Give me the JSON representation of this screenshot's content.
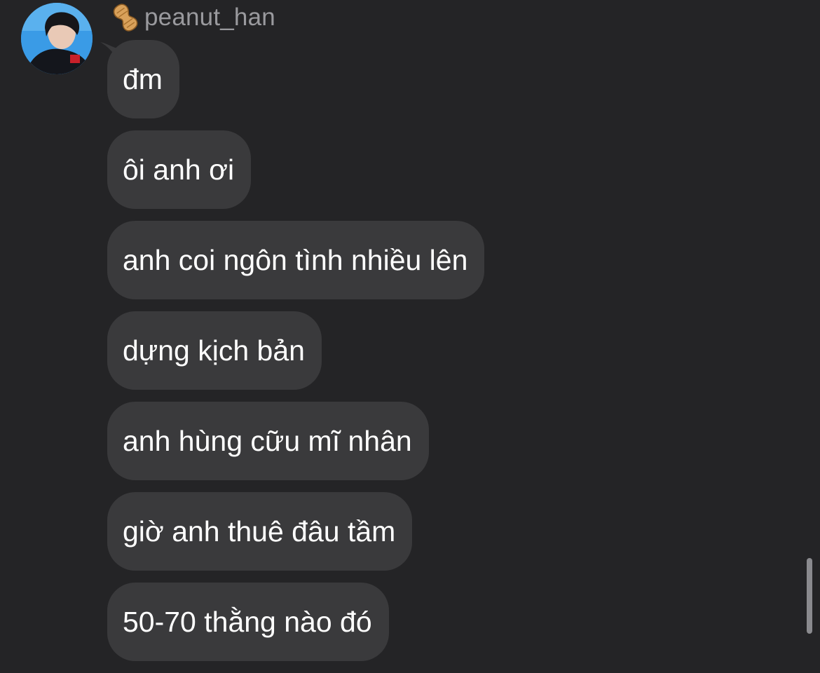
{
  "conversation": {
    "sender": {
      "name": "peanut_han",
      "badge_icon": "peanut-icon",
      "avatar_icon": "avatar"
    },
    "messages": [
      {
        "text": "đm"
      },
      {
        "text": "ôi anh ơi"
      },
      {
        "text": "anh coi ngôn tình nhiều lên"
      },
      {
        "text": "dựng kịch bản"
      },
      {
        "text": "anh hùng cữu mĩ nhân"
      },
      {
        "text": "giờ anh thuê đâu tầm"
      },
      {
        "text": "50-70 thằng nào đó"
      }
    ]
  },
  "colors": {
    "background": "#242426",
    "bubble": "#3a3a3c",
    "message_text": "#ffffff",
    "sender_name": "#9a9a9e",
    "scrollbar": "#8a8a8e"
  }
}
